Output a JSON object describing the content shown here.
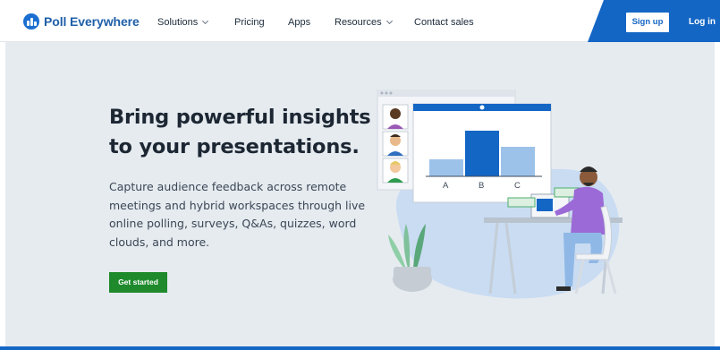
{
  "brand": {
    "name": "Poll Everywhere"
  },
  "nav": {
    "items": [
      {
        "label": "Solutions",
        "has_dropdown": true
      },
      {
        "label": "Pricing",
        "has_dropdown": false
      },
      {
        "label": "Apps",
        "has_dropdown": false
      },
      {
        "label": "Resources",
        "has_dropdown": true
      },
      {
        "label": "Contact sales",
        "has_dropdown": false
      }
    ],
    "signup_label": "Sign up",
    "login_label": "Log in"
  },
  "hero": {
    "title": "Bring powerful insights to your presentations.",
    "subtitle": "Capture audience feedback across remote meetings and hybrid workspaces through live online polling, surveys, Q&As, quizzes, word clouds, and more.",
    "cta_label": "Get started"
  },
  "illustration": {
    "bar_labels": [
      "A",
      "B",
      "C"
    ]
  },
  "colors": {
    "brand_blue": "#1466c5",
    "cta_green": "#1e8a2c",
    "hero_bg": "#e6ebf0"
  }
}
